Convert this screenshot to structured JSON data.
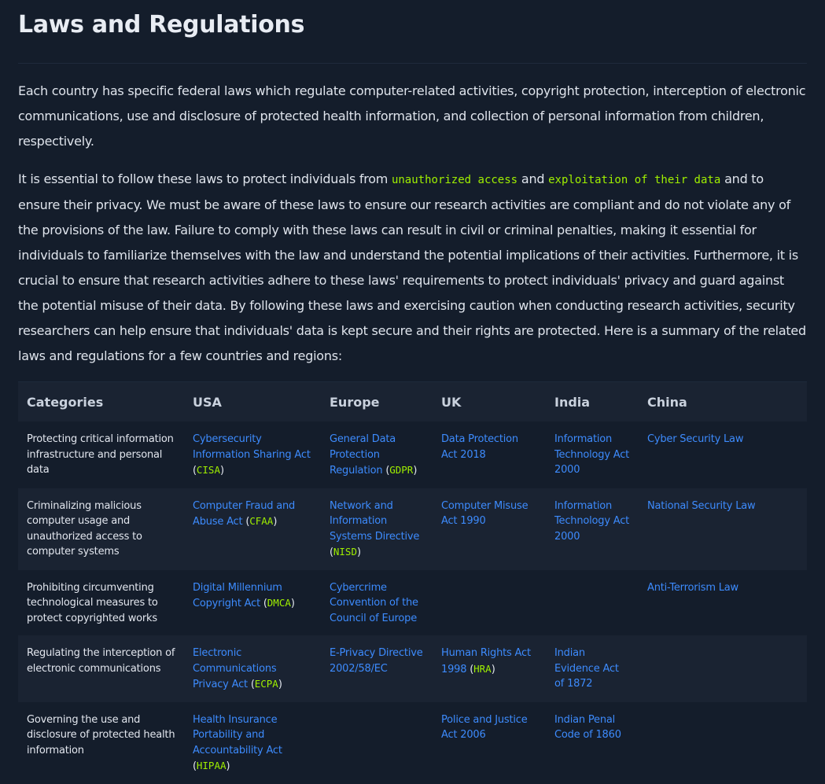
{
  "heading": "Laws and Regulations",
  "para1": "Each country has specific federal laws which regulate computer-related activities, copyright protection, interception of electronic communications, use and disclosure of protected health information, and collection of personal information from children, respectively.",
  "para2": {
    "before": "It is essential to follow these laws to protect individuals from ",
    "code1": "unauthorized access",
    "mid": " and ",
    "code2": "exploitation of their data",
    "after": " and to ensure their privacy. We must be aware of these laws to ensure our research activities are compliant and do not violate any of the provisions of the law. Failure to comply with these laws can result in civil or criminal penalties, making it essential for individuals to familiarize themselves with the law and understand the potential implications of their activities. Furthermore, it is crucial to ensure that research activities adhere to these laws' requirements to protect individuals' privacy and guard against the potential misuse of their data. By following these laws and exercising caution when conducting research activities, security researchers can help ensure that individuals' data is kept secure and their rights are protected. Here is a summary of the related laws and regulations for a few countries and regions:"
  },
  "table": {
    "headers": [
      "Categories",
      "USA",
      "Europe",
      "UK",
      "India",
      "China"
    ],
    "rows": [
      {
        "category": "Protecting critical information infrastructure and personal data",
        "usa": {
          "text": "Cybersecurity Information Sharing Act",
          "abbr": "CISA"
        },
        "europe": {
          "text": "General Data Protection Regulation",
          "abbr": "GDPR"
        },
        "uk": {
          "text": "Data Protection Act 2018",
          "abbr": ""
        },
        "india": {
          "text": "Information Technology Act 2000",
          "abbr": ""
        },
        "china": {
          "text": "Cyber Security Law",
          "abbr": ""
        }
      },
      {
        "category": "Criminalizing malicious computer usage and unauthorized access to computer systems",
        "usa": {
          "text": "Computer Fraud and Abuse Act",
          "abbr": "CFAA"
        },
        "europe": {
          "text": "Network and Information Systems Directive",
          "abbr": "NISD"
        },
        "uk": {
          "text": "Computer Misuse Act 1990",
          "abbr": ""
        },
        "india": {
          "text": "Information Technology Act 2000",
          "abbr": ""
        },
        "china": {
          "text": "National Security Law",
          "abbr": ""
        }
      },
      {
        "category": "Prohibiting circumventing technological measures to protect copyrighted works",
        "usa": {
          "text": "Digital Millennium Copyright Act",
          "abbr": "DMCA"
        },
        "europe": {
          "text": "Cybercrime Convention of the Council of Europe",
          "abbr": ""
        },
        "uk": {
          "text": "",
          "abbr": ""
        },
        "india": {
          "text": "",
          "abbr": ""
        },
        "china": {
          "text": "Anti-Terrorism Law",
          "abbr": ""
        }
      },
      {
        "category": "Regulating the interception of electronic communications",
        "usa": {
          "text": "Electronic Communications Privacy Act",
          "abbr": "ECPA"
        },
        "europe": {
          "text": "E-Privacy Directive 2002/58/EC",
          "abbr": ""
        },
        "uk": {
          "text": "Human Rights Act 1998",
          "abbr": "HRA"
        },
        "india": {
          "text": "Indian Evidence Act of 1872",
          "abbr": ""
        },
        "china": {
          "text": "",
          "abbr": ""
        }
      },
      {
        "category": "Governing the use and disclosure of protected health information",
        "usa": {
          "text": "Health Insurance Portability and Accountability Act",
          "abbr": "HIPAA"
        },
        "europe": {
          "text": "",
          "abbr": ""
        },
        "uk": {
          "text": "Police and Justice Act 2006",
          "abbr": ""
        },
        "india": {
          "text": "Indian Penal Code of 1860",
          "abbr": ""
        },
        "china": {
          "text": "",
          "abbr": ""
        }
      }
    ]
  },
  "colors": {
    "background": "#141d2b",
    "row_alt": "#1a2332",
    "link": "#3d8bfd",
    "code": "#9fef00"
  }
}
